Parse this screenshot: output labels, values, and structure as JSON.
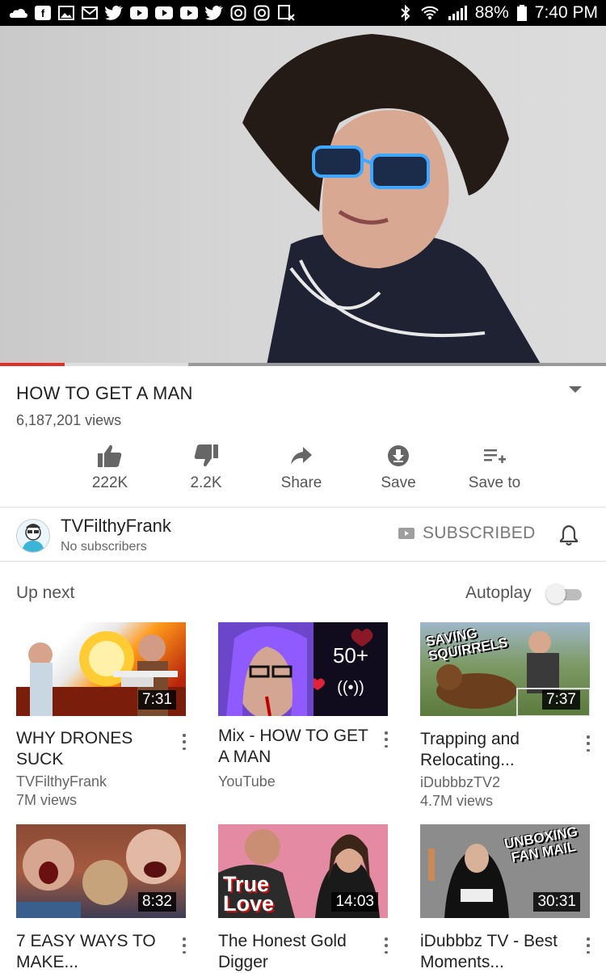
{
  "status": {
    "battery": "88%",
    "time": "7:40 PM"
  },
  "video": {
    "title": "HOW TO GET A MAN",
    "views": "6,187,201 views",
    "progress": 0.107,
    "buffered": 0.31
  },
  "actions": {
    "like": "222K",
    "dislike": "2.2K",
    "share": "Share",
    "save": "Save",
    "save_to": "Save to"
  },
  "channel": {
    "name": "TVFilthyFrank",
    "subs": "No subscribers",
    "subscribed": "SUBSCRIBED"
  },
  "upnext": {
    "label": "Up next",
    "autoplay": "Autoplay",
    "autoplay_on": false
  },
  "items": [
    {
      "title": "WHY DRONES SUCK",
      "channel": "TVFilthyFrank",
      "views": "7M views",
      "duration": "7:31"
    },
    {
      "title": "Mix - HOW TO GET A MAN",
      "channel": "YouTube",
      "views": "",
      "mix_count": "50+"
    },
    {
      "title": "Trapping and Relocating...",
      "channel": "iDubbbzTV2",
      "views": "4.7M views",
      "duration": "7:37",
      "thumb_text": "SAVING SQUIRRELS"
    },
    {
      "title": "7 EASY WAYS TO MAKE...",
      "duration": "8:32"
    },
    {
      "title": "The Honest Gold Digger",
      "duration": "14:03",
      "thumb_text": "True Love"
    },
    {
      "title": "iDubbbz TV - Best Moments...",
      "duration": "30:31",
      "thumb_text": "UNBOXING FAN MAIL"
    }
  ],
  "colors": {
    "accent": "#e52d27"
  }
}
